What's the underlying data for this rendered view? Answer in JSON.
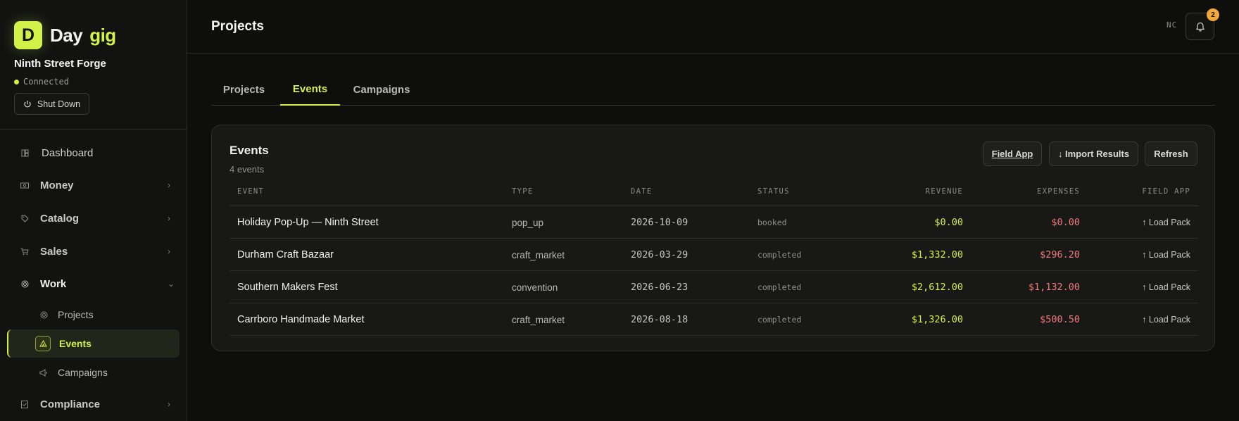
{
  "brand": {
    "logo_letter": "D",
    "word_part1": "Day",
    "word_part2": "gig",
    "accent_color": "#d4f14a"
  },
  "org": {
    "name": "Ninth Street Forge",
    "status": "Connected",
    "shutdown_label": "Shut Down"
  },
  "nav": {
    "dashboard": "Dashboard",
    "money": "Money",
    "catalog": "Catalog",
    "sales": "Sales",
    "work": "Work",
    "work_children": {
      "projects": "Projects",
      "events": "Events",
      "campaigns": "Campaigns"
    },
    "compliance": "Compliance"
  },
  "header": {
    "title": "Projects",
    "user_initials": "NC",
    "notification_count": "2"
  },
  "tabs": {
    "projects": "Projects",
    "events": "Events",
    "campaigns": "Campaigns",
    "active": "Events"
  },
  "card": {
    "title": "Events",
    "subtitle": "4 events",
    "buttons": {
      "field_app": "Field App",
      "import": "↓ Import Results",
      "refresh": "Refresh"
    },
    "columns": {
      "event": "EVENT",
      "type": "TYPE",
      "date": "DATE",
      "status": "STATUS",
      "revenue": "REVENUE",
      "expenses": "EXPENSES",
      "field_app": "FIELD APP"
    },
    "rows": [
      {
        "event": "Holiday Pop-Up — Ninth Street",
        "type": "pop_up",
        "date": "2026-10-09",
        "status": "booked",
        "revenue": "$0.00",
        "expenses": "$0.00",
        "action": "↑ Load Pack"
      },
      {
        "event": "Durham Craft Bazaar",
        "type": "craft_market",
        "date": "2026-03-29",
        "status": "completed",
        "revenue": "$1,332.00",
        "expenses": "$296.20",
        "action": "↑ Load Pack"
      },
      {
        "event": "Southern Makers Fest",
        "type": "convention",
        "date": "2026-06-23",
        "status": "completed",
        "revenue": "$2,612.00",
        "expenses": "$1,132.00",
        "action": "↑ Load Pack"
      },
      {
        "event": "Carrboro Handmade Market",
        "type": "craft_market",
        "date": "2026-08-18",
        "status": "completed",
        "revenue": "$1,326.00",
        "expenses": "$500.50",
        "action": "↑ Load Pack"
      }
    ]
  },
  "colors": {
    "revenue": "#d4f14a",
    "expenses": "#f07a7a",
    "badge": "#f2a93b"
  }
}
